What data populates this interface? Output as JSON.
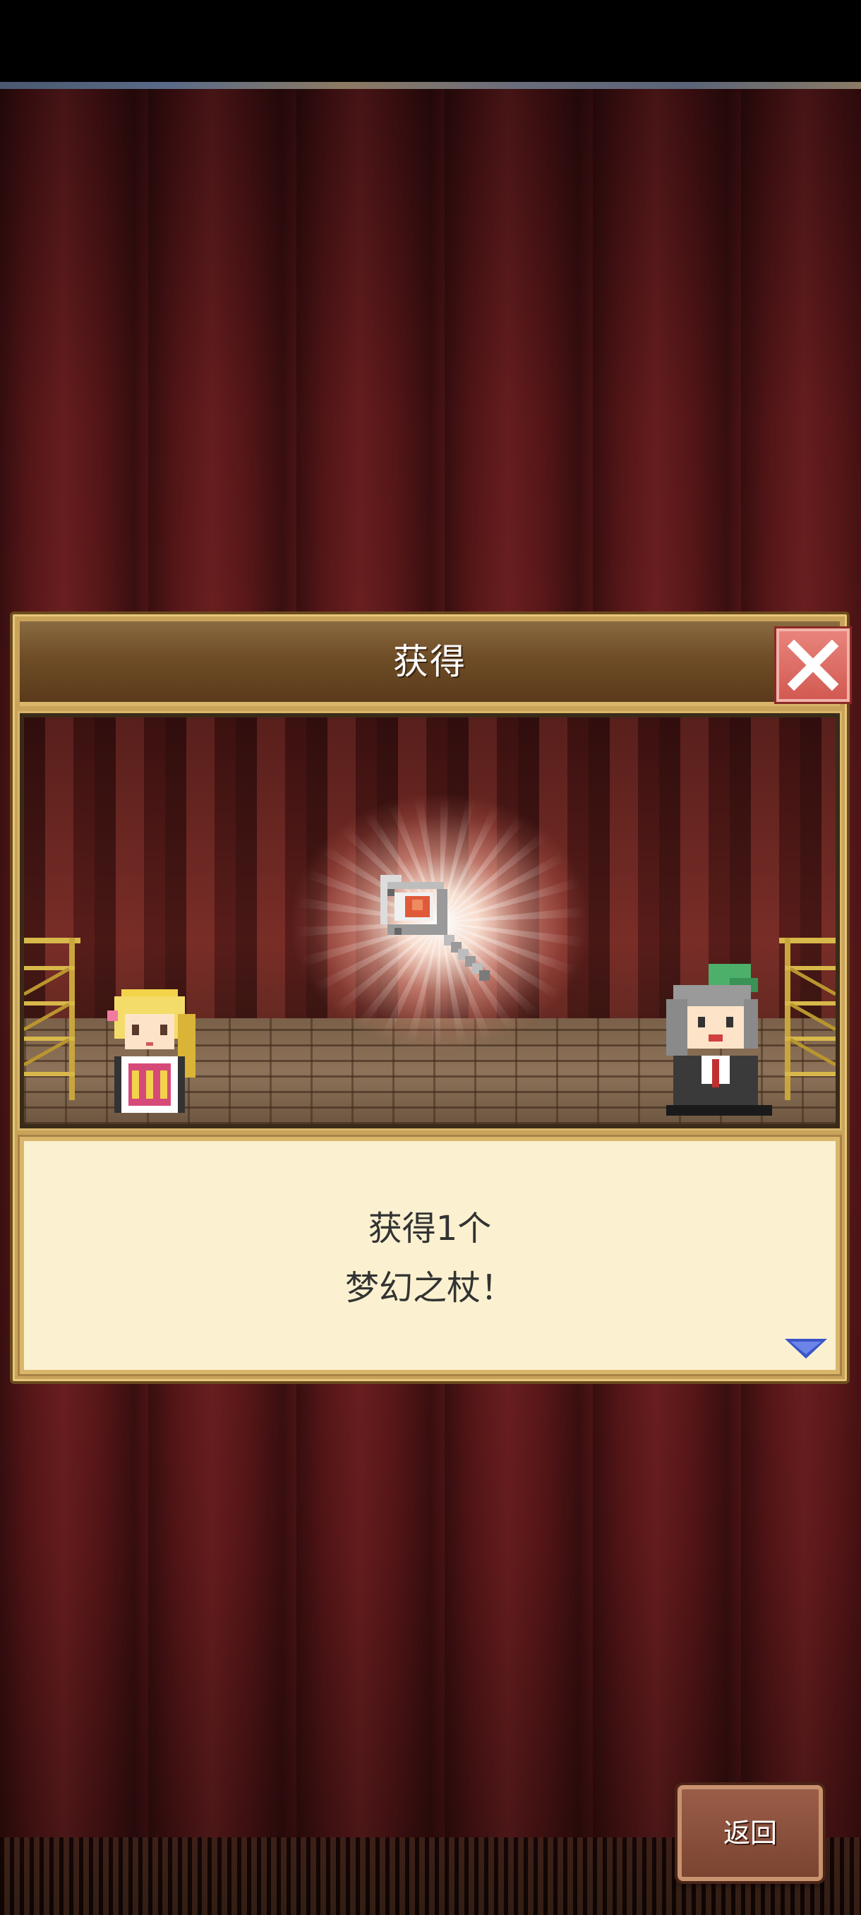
{
  "dialog": {
    "title": "获得",
    "message_line1": "获得1个",
    "message_line2": "梦幻之杖！"
  },
  "footer": {
    "back_label": "返回"
  },
  "icons": {
    "close": "close-icon",
    "item": "magic-wand-icon",
    "next": "next-arrow-icon"
  },
  "colors": {
    "close_button": "#d25a52",
    "dialog_frame": "#c9a35a",
    "message_bg": "#fbf1d0",
    "next_arrow": "#3a55c8"
  }
}
